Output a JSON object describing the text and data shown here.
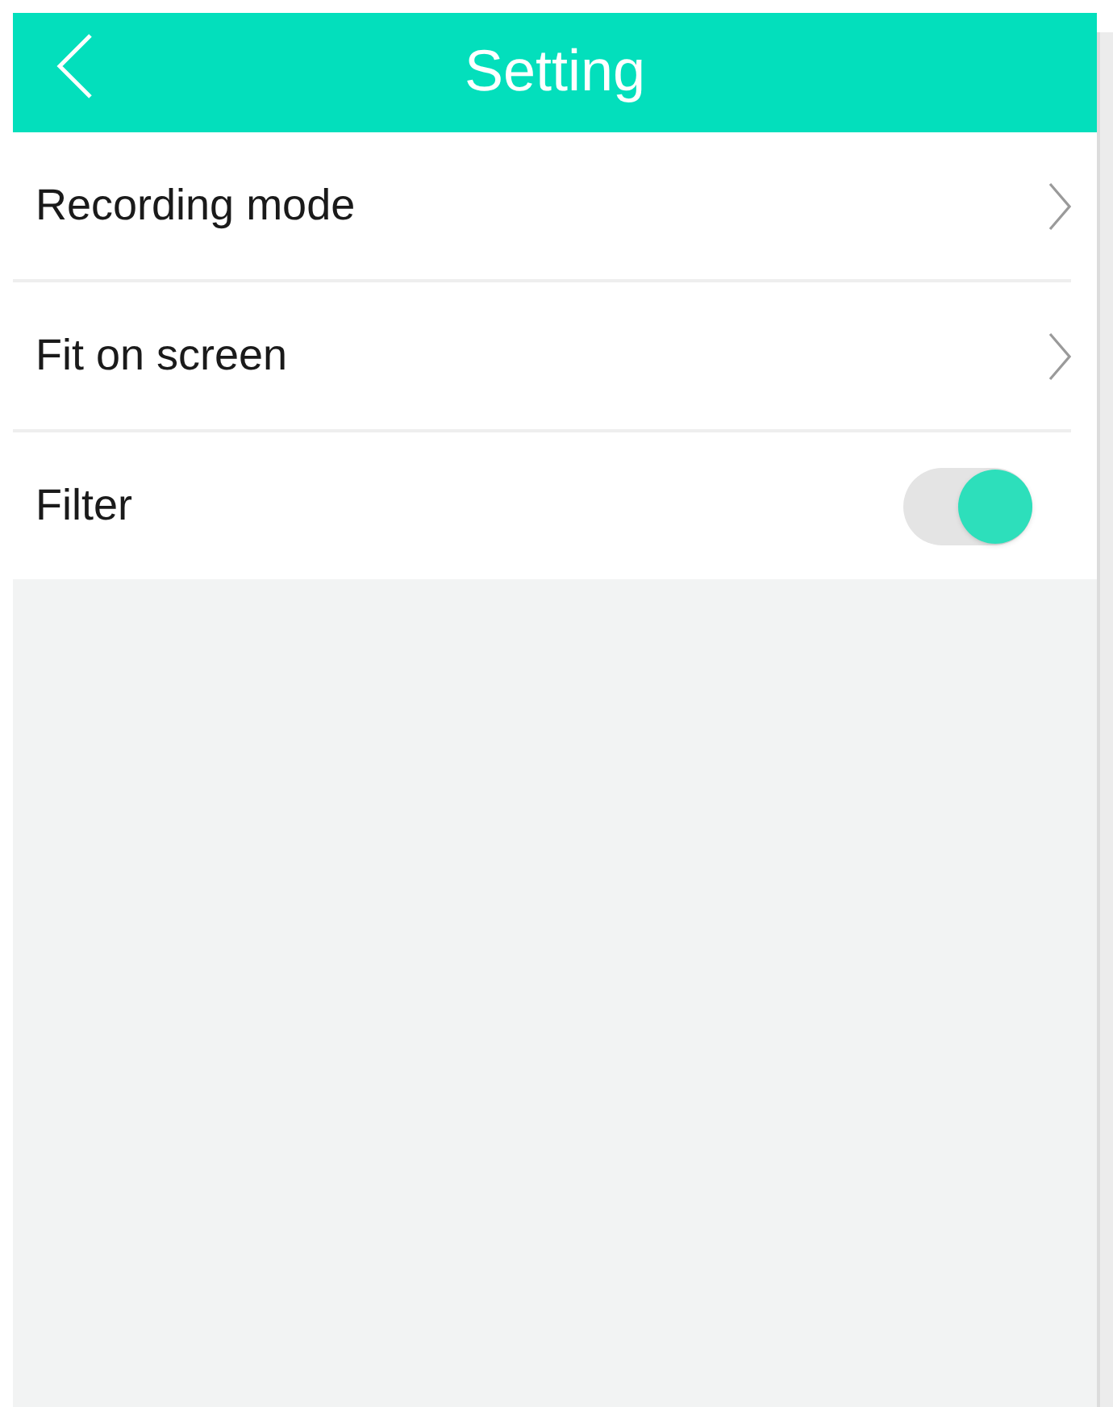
{
  "header": {
    "title": "Setting"
  },
  "items": [
    {
      "kind": "link",
      "label": "Recording mode"
    },
    {
      "kind": "link",
      "label": "Fit on screen"
    },
    {
      "kind": "toggle",
      "label": "Filter",
      "on": true
    }
  ]
}
